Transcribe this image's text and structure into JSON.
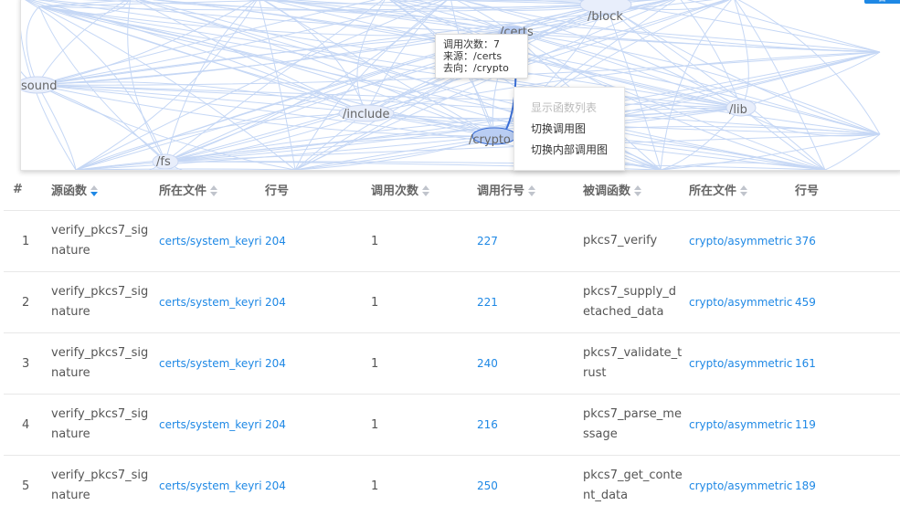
{
  "graph": {
    "nodes": [
      {
        "id": "block",
        "label": "/block"
      },
      {
        "id": "certs",
        "label": "/certs"
      },
      {
        "id": "sound",
        "label": "sound"
      },
      {
        "id": "include",
        "label": "/include"
      },
      {
        "id": "lib",
        "label": "/lib"
      },
      {
        "id": "crypto",
        "label": "/crypto"
      },
      {
        "id": "fs",
        "label": "/fs"
      }
    ],
    "tooltip": {
      "count_line": "调用次数：7",
      "source_line": "来源：/certs",
      "target_line": "去向：/crypto"
    },
    "context_menu": {
      "show_functions": "显示函数列表",
      "switch_call_graph": "切换调用图",
      "switch_internal_call_graph": "切换内部调用图"
    },
    "corner_button": "日",
    "edge_color": "#c5d7f5",
    "highlight_color": "#3b6fd6"
  },
  "table": {
    "headers": {
      "index": "#",
      "source_func": "源函数",
      "source_file": "所在文件",
      "source_line": "行号",
      "call_count": "调用次数",
      "call_line": "调用行号",
      "callee": "被调函数",
      "callee_file": "所在文件",
      "callee_line": "行号"
    },
    "rows": [
      {
        "index": "1",
        "source_func": "verify_pkcs7_signature",
        "source_file": "certs/system_keyri",
        "source_line": "204",
        "call_count": "1",
        "call_line": "227",
        "callee": "pkcs7_verify",
        "callee_file": "crypto/asymmetric",
        "callee_line": "376"
      },
      {
        "index": "2",
        "source_func": "verify_pkcs7_signature",
        "source_file": "certs/system_keyri",
        "source_line": "204",
        "call_count": "1",
        "call_line": "221",
        "callee": "pkcs7_supply_detached_data",
        "callee_file": "crypto/asymmetric",
        "callee_line": "459"
      },
      {
        "index": "3",
        "source_func": "verify_pkcs7_signature",
        "source_file": "certs/system_keyri",
        "source_line": "204",
        "call_count": "1",
        "call_line": "240",
        "callee": "pkcs7_validate_trust",
        "callee_file": "crypto/asymmetric",
        "callee_line": "161"
      },
      {
        "index": "4",
        "source_func": "verify_pkcs7_signature",
        "source_file": "certs/system_keyri",
        "source_line": "204",
        "call_count": "1",
        "call_line": "216",
        "callee": "pkcs7_parse_message",
        "callee_file": "crypto/asymmetric",
        "callee_line": "119"
      },
      {
        "index": "5",
        "source_func": "verify_pkcs7_signature",
        "source_file": "certs/system_keyri",
        "source_line": "204",
        "call_count": "1",
        "call_line": "250",
        "callee": "pkcs7_get_content_data",
        "callee_file": "crypto/asymmetric",
        "callee_line": "189"
      }
    ]
  }
}
